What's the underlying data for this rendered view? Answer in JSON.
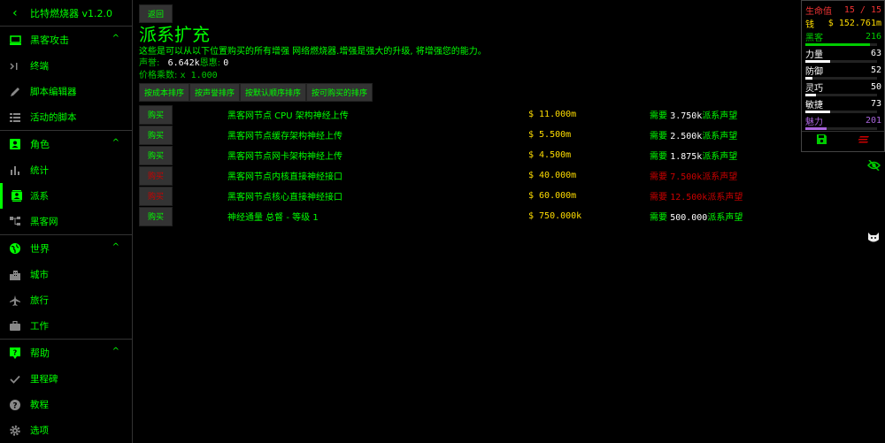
{
  "sidebar": {
    "title": "比特燃烧器 v1.2.0",
    "sections": [
      {
        "label": "黑客攻击",
        "items": [
          "终端",
          "脚本编辑器",
          "活动的脚本"
        ]
      },
      {
        "label": "角色",
        "items": [
          "统计",
          "派系",
          "黑客网"
        ]
      },
      {
        "label": "世界",
        "items": [
          "城市",
          "旅行",
          "工作"
        ]
      },
      {
        "label": "帮助",
        "items": [
          "里程碑",
          "教程",
          "选项"
        ]
      }
    ]
  },
  "main": {
    "back_label": "返回",
    "title": "派系扩充",
    "description": "这些是可以从以下位置购买的所有增强 网络燃烧器.增强是强大的升级, 将增强您的能力。",
    "rep_label": "声誉:",
    "rep_value": "6.642k",
    "favor_label": "恩惠:",
    "favor_value": "0",
    "price_mult_label": "价格乘数:",
    "price_mult_value": "x 1.000",
    "sort_buttons": [
      "按成本排序",
      "按声誉排序",
      "按默认顺序排序",
      "按可购买的排序"
    ],
    "augmentations": [
      {
        "buy": "购买",
        "name": "黑客网节点 CPU 架构神经上传",
        "price": "$ 11.000m",
        "req_label": "需要",
        "req_value": "3.750k",
        "req_suffix": "派系声望",
        "affordable": true
      },
      {
        "buy": "购买",
        "name": "黑客网节点缓存架构神经上传",
        "price": "$ 5.500m",
        "req_label": "需要",
        "req_value": "2.500k",
        "req_suffix": "派系声望",
        "affordable": true
      },
      {
        "buy": "购买",
        "name": "黑客网节点网卡架构神经上传",
        "price": "$ 4.500m",
        "req_label": "需要",
        "req_value": "1.875k",
        "req_suffix": "派系声望",
        "affordable": true
      },
      {
        "buy": "购买",
        "name": "黑客网节点内核直接神经接口",
        "price": "$ 40.000m",
        "req_label": "需要",
        "req_value": "7.500k",
        "req_suffix": "派系声望",
        "affordable": false
      },
      {
        "buy": "购买",
        "name": "黑客网节点核心直接神经接口",
        "price": "$ 60.000m",
        "req_label": "需要",
        "req_value": "12.500k",
        "req_suffix": "派系声望",
        "affordable": false
      },
      {
        "buy": "购买",
        "name": "神经通量 总督 - 等级 1",
        "price": "$ 750.000k",
        "req_label": "需要",
        "req_value": "500.000",
        "req_suffix": "派系声望",
        "affordable": true
      }
    ]
  },
  "overview": {
    "hp_label": "生命值",
    "hp_value": "15 / 15",
    "money_label": "钱",
    "money_value": "$ 152.761m",
    "hack_label": "黑客",
    "hack_value": "216",
    "hack_progress": 0.9,
    "str_label": "力量",
    "str_value": "63",
    "str_progress": 0.35,
    "def_label": "防御",
    "def_value": "52",
    "def_progress": 0.1,
    "dex_label": "灵巧",
    "dex_value": "50",
    "dex_progress": 0.15,
    "agi_label": "敏捷",
    "agi_value": "73",
    "agi_progress": 0.35,
    "cha_label": "魅力",
    "cha_value": "201",
    "cha_progress": 0.3
  },
  "colors": {
    "hack": "#0c0",
    "hp": "#e33",
    "money": "#fd0",
    "cha": "#a6d",
    "stat": "#fff"
  }
}
